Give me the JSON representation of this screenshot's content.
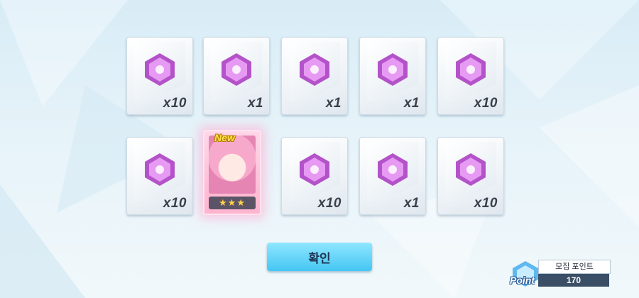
{
  "rewards": [
    {
      "type": "gem",
      "qty": "x10"
    },
    {
      "type": "gem",
      "qty": "x1"
    },
    {
      "type": "gem",
      "qty": "x1"
    },
    {
      "type": "gem",
      "qty": "x1"
    },
    {
      "type": "gem",
      "qty": "x10"
    },
    {
      "type": "gem",
      "qty": "x10"
    },
    {
      "type": "character",
      "badge": "New",
      "stars": "★★★"
    },
    {
      "type": "gem",
      "qty": "x10"
    },
    {
      "type": "gem",
      "qty": "x1"
    },
    {
      "type": "gem",
      "qty": "x10"
    }
  ],
  "confirm_label": "확인",
  "point_panel": {
    "icon_word": "Point",
    "title": "모집 포인트",
    "value": "170"
  },
  "colors": {
    "gem": "#d57be8",
    "confirm": "#5fd3f7",
    "accent_new": "#ffe14d"
  }
}
